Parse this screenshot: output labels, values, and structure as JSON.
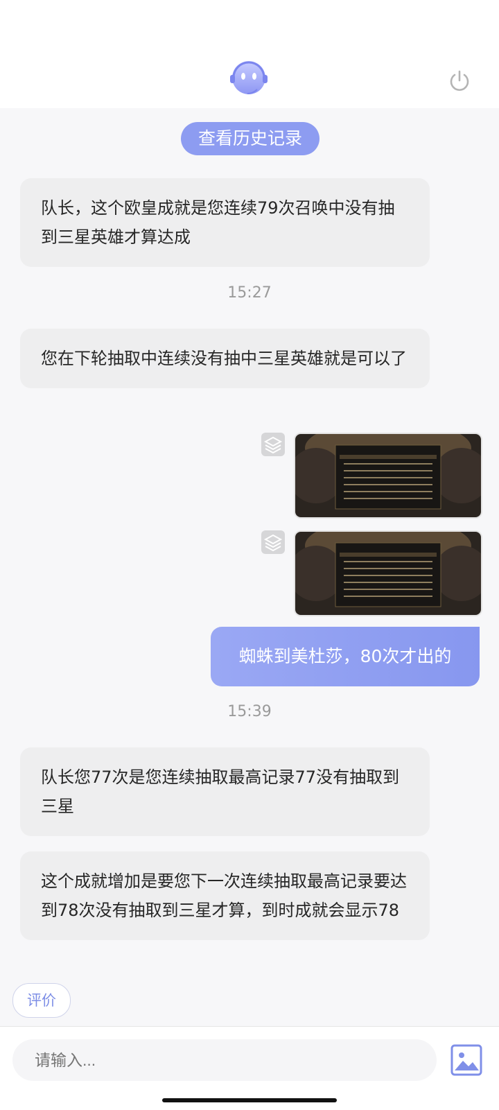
{
  "header": {
    "bot_icon": "robot-headset-avatar",
    "power_icon": "power-icon"
  },
  "history_button": "查看历史记录",
  "messages": [
    {
      "side": "left",
      "text": "队长，这个欧皇成就是您连续79次召唤中没有抽到三星英雄才算达成"
    },
    {
      "type": "time",
      "text": "15:27"
    },
    {
      "side": "left",
      "text": "您在下轮抽取中连续没有抽中三星英雄就是可以了"
    },
    {
      "side": "right",
      "type": "image",
      "icon": "layers-icon"
    },
    {
      "side": "right",
      "type": "image",
      "icon": "layers-icon"
    },
    {
      "side": "right",
      "text": "蜘蛛到美杜莎，80次才出的"
    },
    {
      "type": "time",
      "text": "15:39"
    },
    {
      "side": "left",
      "text": "队长您77次是您连续抽取最高记录77没有抽取到三星"
    },
    {
      "side": "left",
      "text": "这个成就增加是要您下一次连续抽取最高记录要达到78次没有抽取到三星才算，到时成就会显示78"
    }
  ],
  "rate_button": "评价",
  "input": {
    "placeholder": "请输入..."
  },
  "image_button_icon": "image-icon",
  "colors": {
    "accent": "#8d9cf1",
    "bubble_left": "#eeeeef",
    "background": "#f7f7f9"
  }
}
